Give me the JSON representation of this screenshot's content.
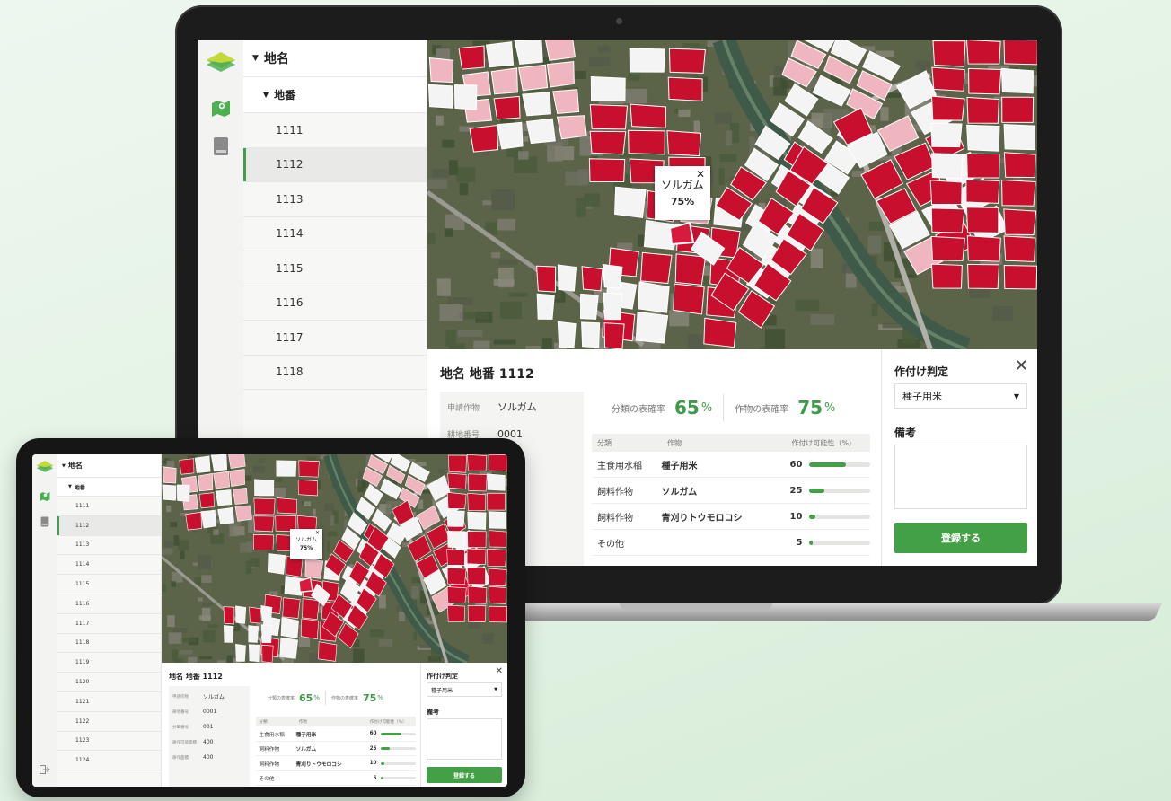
{
  "nav": {
    "items": [
      {
        "icon": "map-icon"
      },
      {
        "icon": "book-icon"
      }
    ],
    "logout_icon": "logout-icon"
  },
  "tree": {
    "area_label": "地名",
    "lot_label": "地番",
    "laptop_lots": [
      "1111",
      "1112",
      "1113",
      "1114",
      "1115",
      "1116",
      "1117",
      "1118"
    ],
    "tablet_lots": [
      "1111",
      "1112",
      "1113",
      "1114",
      "1115",
      "1116",
      "1117",
      "1118",
      "1119",
      "1120",
      "1121",
      "1122",
      "1123",
      "1124"
    ],
    "selected": "1112"
  },
  "map": {
    "popup": {
      "crop": "ソルガム",
      "percent": "75%"
    }
  },
  "detail": {
    "title": "地名 地番 1112",
    "info": [
      {
        "label": "申請作物",
        "value": "ソルガム"
      },
      {
        "label": "耕地番号",
        "value": "0001"
      },
      {
        "label": "分筆番号",
        "value": "001"
      },
      {
        "label": "耕作可能面積",
        "value": "400"
      },
      {
        "label": "耕作面積",
        "value": "400"
      }
    ],
    "category_agreement_label": "分類の表確率",
    "category_agreement_value": "65",
    "crop_agreement_label": "作物の表確率",
    "crop_agreement_value": "75",
    "percent_unit": "%",
    "table": {
      "headers": [
        "分類",
        "作物",
        "作付け可能性（%）"
      ],
      "rows": [
        {
          "category": "主食用水稲",
          "crop": "種子用米",
          "value": 60
        },
        {
          "category": "飼料作物",
          "crop": "ソルガム",
          "value": 25
        },
        {
          "category": "飼料作物",
          "crop": "青刈りトウモロコシ",
          "value": 10
        },
        {
          "category": "その他",
          "crop": "",
          "value": 5
        }
      ]
    }
  },
  "panel": {
    "judgement_label": "作付け判定",
    "selected_option": "種子用米",
    "remarks_label": "備考",
    "remarks_value": "",
    "submit_label": "登録する"
  },
  "colors": {
    "accent": "#43a047",
    "parcel_red": "#c8102e",
    "parcel_white": "#f4f4f4",
    "parcel_pink": "#efb6bf"
  }
}
